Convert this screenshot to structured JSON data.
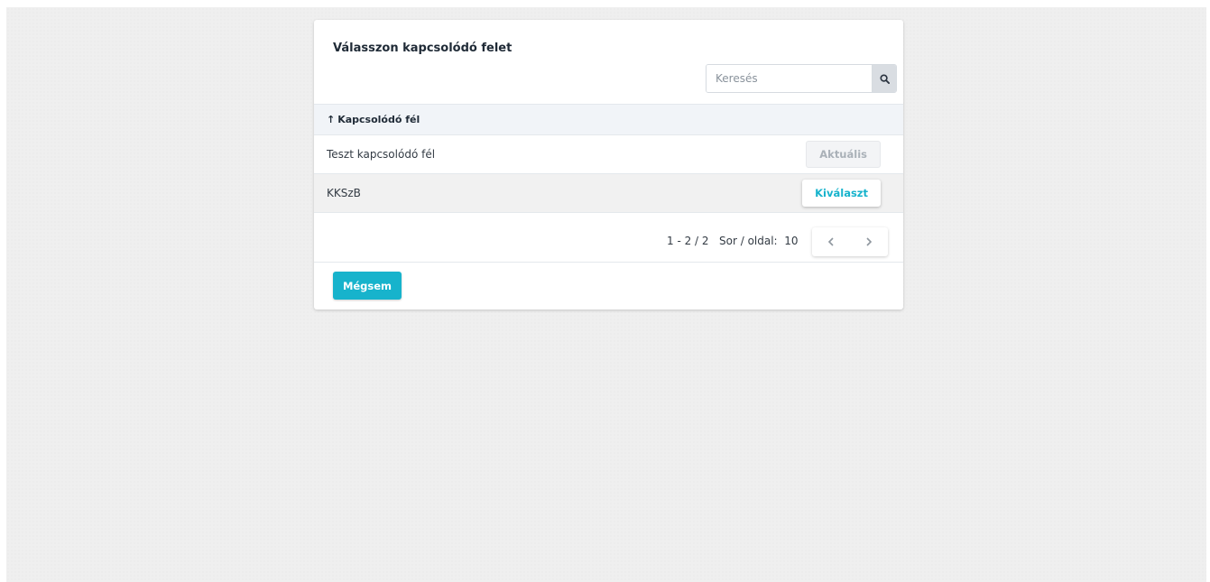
{
  "dialog": {
    "title": "Válasszon kapcsolódó felet",
    "search": {
      "placeholder": "Keresés",
      "value": ""
    },
    "table": {
      "sort_arrow": "↑",
      "column_header": "Kapcsolódó fél",
      "rows": [
        {
          "name": "Teszt kapcsolódó fél",
          "action": "Aktuális"
        },
        {
          "name": "KKSzB",
          "action": "Kiválaszt"
        }
      ]
    },
    "pagination": {
      "range": "1 - 2 / 2",
      "rows_per_page": "Sor / oldal:  10"
    },
    "cancel_label": "Mégsem"
  },
  "colors": {
    "accent": "#17b3cc",
    "header_bg": "#f1f4f8",
    "disabled_text": "#aab1b8"
  },
  "icons": {
    "search": "search-icon",
    "prev": "chevron-left-icon",
    "next": "chevron-right-icon"
  }
}
